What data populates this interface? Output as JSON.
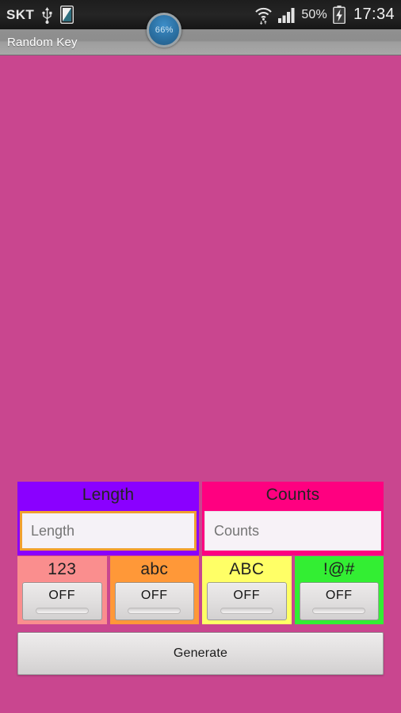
{
  "status_bar": {
    "carrier": "SKT",
    "usb_icon": "usb-icon",
    "screen_icon": "phone-screen-icon",
    "battery_percent_badge": "66%",
    "wifi_icon": "wifi-icon",
    "signal_icon": "cellular-signal-icon",
    "battery_percent": "50%",
    "battery_icon": "battery-charging-icon",
    "clock": "17:34"
  },
  "title_bar": {
    "title": "Random Key"
  },
  "colors": {
    "background": "#c9468f",
    "length_header": "#8a00ff",
    "counts_header": "#ff0080",
    "focus_ring": "#f0a030",
    "numbers_cell": "#fa8e8e",
    "lowercase_cell": "#ff9838",
    "uppercase_cell": "#ffff66",
    "symbols_cell": "#33ee33"
  },
  "fields": [
    {
      "id": "length",
      "header": "Length",
      "placeholder": "Length",
      "value": "",
      "focused": true
    },
    {
      "id": "counts",
      "header": "Counts",
      "placeholder": "Counts",
      "value": "",
      "focused": false
    }
  ],
  "toggles": [
    {
      "id": "numbers",
      "label": "123",
      "state": "OFF"
    },
    {
      "id": "lowercase",
      "label": "abc",
      "state": "OFF"
    },
    {
      "id": "uppercase",
      "label": "ABC",
      "state": "OFF"
    },
    {
      "id": "symbols",
      "label": "!@#",
      "state": "OFF"
    }
  ],
  "actions": {
    "generate": "Generate"
  }
}
